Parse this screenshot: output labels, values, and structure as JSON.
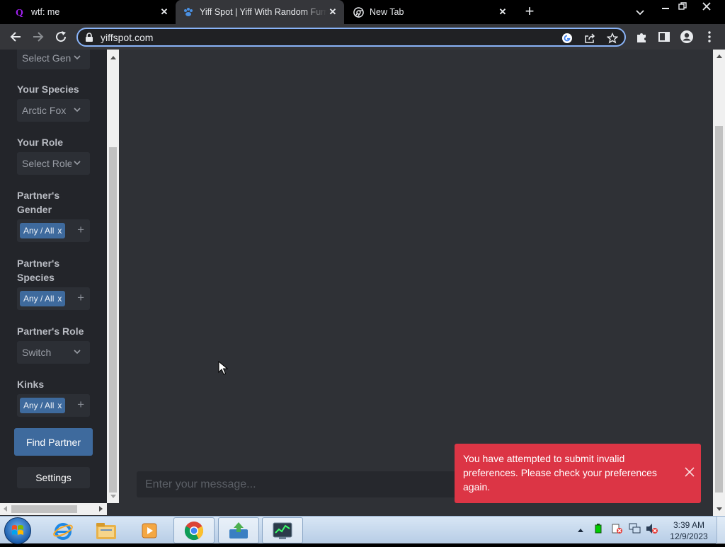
{
  "browser": {
    "tabs": [
      {
        "title": "wtf: me",
        "icon": "quora-icon",
        "active": false
      },
      {
        "title": "Yiff Spot | Yiff With Random Furri",
        "icon": "paw-icon",
        "active": true
      },
      {
        "title": "New Tab",
        "icon": "chrome-icon",
        "active": false
      }
    ],
    "url": "yiffspot.com"
  },
  "sidebar": {
    "gender_value": "Select Gen",
    "species_label": "Your Species",
    "species_value": "Arctic Fox",
    "role_label": "Your Role",
    "role_value": "Select Role",
    "partner_gender_label_1": "Partner's",
    "partner_gender_label_2": "Gender",
    "partner_gender_chip": "Any / All",
    "partner_species_label_1": "Partner's",
    "partner_species_label_2": "Species",
    "partner_species_chip": "Any / All",
    "partner_role_label": "Partner's Role",
    "partner_role_value": "Switch",
    "kinks_label": "Kinks",
    "kinks_chip": "Any / All",
    "chip_remove": "x",
    "add_symbol": "+",
    "find_partner": "Find Partner",
    "settings": "Settings"
  },
  "chat": {
    "placeholder": "Enter your message..."
  },
  "toast": {
    "line1": "You have attempted to submit invalid",
    "line2": "preferences. Please check your preferences",
    "line3": "again."
  },
  "taskbar": {
    "time": "3:39 AM",
    "date": "12/9/2023",
    "pinned": [
      "ie-icon",
      "explorer-icon",
      "media-player-icon",
      "chrome-icon",
      "download-app-icon",
      "task-manager-icon"
    ]
  },
  "colors": {
    "accent": "#3e6a9d",
    "error": "#dc3545",
    "page_bg": "#2f3136",
    "sidebar_bg": "#23252a"
  }
}
